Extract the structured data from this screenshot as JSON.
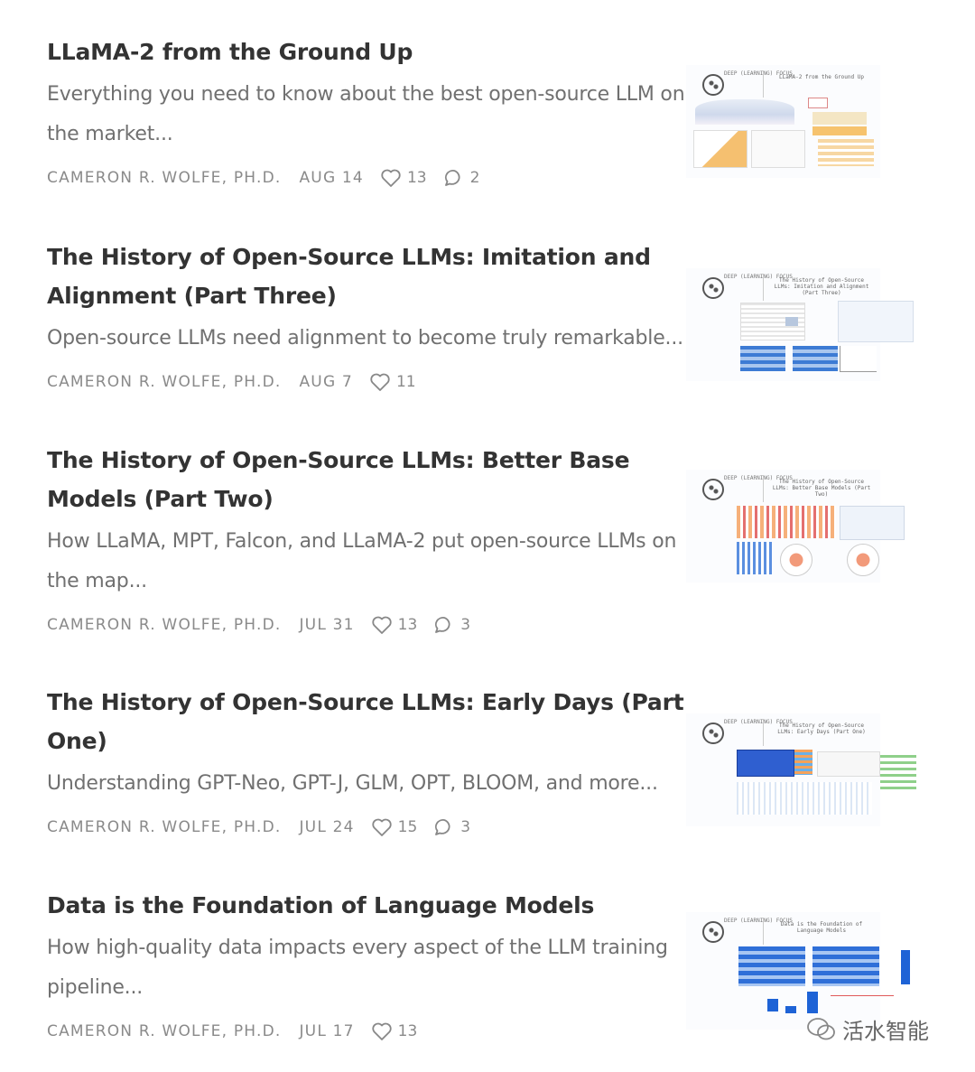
{
  "posts": [
    {
      "title": "LLaMA-2 from the Ground Up",
      "subtitle": "Everything you need to know about the best open-source LLM on the market...",
      "author": "CAMERON R. WOLFE, PH.D.",
      "date": "AUG 14",
      "likes": "13",
      "comments": "2",
      "thumb_title": "LLaMA-2 from the Ground Up"
    },
    {
      "title": "The History of Open-Source LLMs: Imitation and Alignment (Part Three)",
      "subtitle": "Open-source LLMs need alignment to become truly remarkable...",
      "author": "CAMERON R. WOLFE, PH.D.",
      "date": "AUG 7",
      "likes": "11",
      "thumb_title": "The History of Open-Source LLMs: Imitation and Alignment (Part Three)"
    },
    {
      "title": "The History of Open-Source LLMs: Better Base Models (Part Two)",
      "subtitle": "How LLaMA, MPT, Falcon, and LLaMA-2 put open-source LLMs on the map...",
      "author": "CAMERON R. WOLFE, PH.D.",
      "date": "JUL 31",
      "likes": "13",
      "comments": "3",
      "thumb_title": "The History of Open-Source LLMs: Better Base Models (Part Two)"
    },
    {
      "title": "The History of Open-Source LLMs: Early Days (Part One)",
      "subtitle": "Understanding GPT-Neo, GPT-J, GLM, OPT, BLOOM, and more...",
      "author": "CAMERON R. WOLFE, PH.D.",
      "date": "JUL 24",
      "likes": "15",
      "comments": "3",
      "thumb_title": "The History of Open-Source LLMs: Early Days (Part One)"
    },
    {
      "title": "Data is the Foundation of Language Models",
      "subtitle": "How high-quality data impacts every aspect of the LLM training pipeline...",
      "author": "CAMERON R. WOLFE, PH.D.",
      "date": "JUL 17",
      "likes": "13",
      "thumb_title": "Data is the Foundation of Language Models"
    }
  ],
  "thumb_logo_text": "DEEP (LEARNING) FOCUS",
  "watermark": "活水智能",
  "icons": {
    "like": "heart-icon",
    "comment": "comment-bubble-icon",
    "watermark": "wechat-icon"
  },
  "colors": {
    "title": "#333333",
    "subtitle": "#707070",
    "meta": "#8a8a8a"
  }
}
